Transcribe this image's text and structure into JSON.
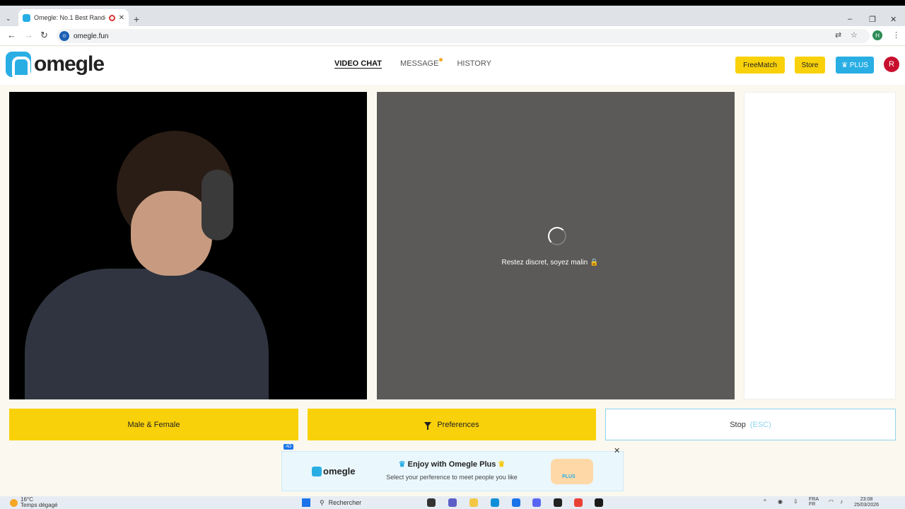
{
  "browser": {
    "tab_title": "Omegle: No.1 Best Random",
    "url": "omegle.fun",
    "profile_initial": "H"
  },
  "header": {
    "logo_text": "omegle",
    "nav": [
      {
        "label": "VIDEO CHAT",
        "active": true
      },
      {
        "label": "MESSAGE",
        "active": false,
        "badge_dot": true
      },
      {
        "label": "HISTORY",
        "active": false
      }
    ],
    "freematch_label": "FreeMatch",
    "store_label": "Store",
    "plus_label": "♛ PLUS",
    "avatar_initial": "R"
  },
  "video": {
    "remote_status": "Restez discret, soyez malin 🔒"
  },
  "actions": {
    "gender_label": "Male & Female",
    "preferences_label": "Preferences",
    "stop_label": "Stop",
    "stop_shortcut": "(ESC)"
  },
  "ad": {
    "badge": "AD",
    "logo_text": "omegle",
    "title": "Enjoy with Omegle Plus",
    "subtitle": "Select your perference to meet people you like",
    "art_label": "PLUS"
  },
  "taskbar": {
    "weather_temp": "16°C",
    "weather_desc": "Temps dégagé",
    "search_placeholder": "Rechercher",
    "lang": "FRA",
    "lang_sub": "FR",
    "time": "23:08",
    "date": "25/03/2026"
  },
  "colors": {
    "accent_yellow": "#f9d10a",
    "accent_blue": "#29aee4",
    "avatar_red": "#c8102e"
  }
}
